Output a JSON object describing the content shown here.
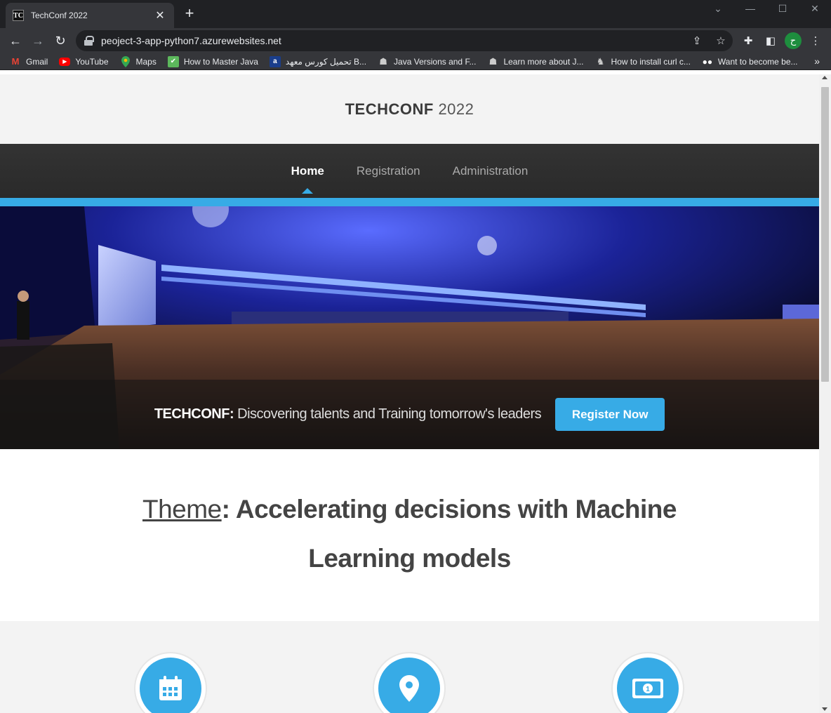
{
  "browser": {
    "tab_title": "TechConf 2022",
    "tab_favicon_text": "TC",
    "url": "peoject-3-app-python7.azurewebsites.net",
    "profile_initial": "ح",
    "bookmarks": [
      {
        "label": "Gmail",
        "icon": "gmail-icon"
      },
      {
        "label": "YouTube",
        "icon": "youtube-icon"
      },
      {
        "label": "Maps",
        "icon": "maps-icon"
      },
      {
        "label": "How to Master Java",
        "icon": "bookmark-icon"
      },
      {
        "label": "تحميل كورس معهد B...",
        "icon": "bookmark-icon"
      },
      {
        "label": "Java Versions and F...",
        "icon": "bookmark-icon"
      },
      {
        "label": "Learn more about J...",
        "icon": "bookmark-icon"
      },
      {
        "label": "How to install curl c...",
        "icon": "bookmark-icon"
      },
      {
        "label": "Want to become be...",
        "icon": "medium-icon"
      }
    ]
  },
  "site": {
    "logo_bold": "TECHCONF",
    "logo_year": " 2022",
    "nav": [
      {
        "label": "Home",
        "active": true
      },
      {
        "label": "Registration",
        "active": false
      },
      {
        "label": "Administration",
        "active": false
      }
    ],
    "hero": {
      "tagline_bold": "TECHCONF:",
      "tagline_text": " Discovering talents and Training tomorrow's leaders",
      "cta_label": "Register Now"
    },
    "theme": {
      "label": "Theme",
      "text": ": Accelerating decisions with Machine Learning models"
    },
    "features": [
      {
        "icon": "calendar-icon"
      },
      {
        "icon": "location-pin-icon"
      },
      {
        "icon": "money-icon"
      }
    ]
  },
  "colors": {
    "accent": "#37abe6",
    "nav_bg": "#2d2d2d",
    "header_bg": "#f3f3f3"
  }
}
